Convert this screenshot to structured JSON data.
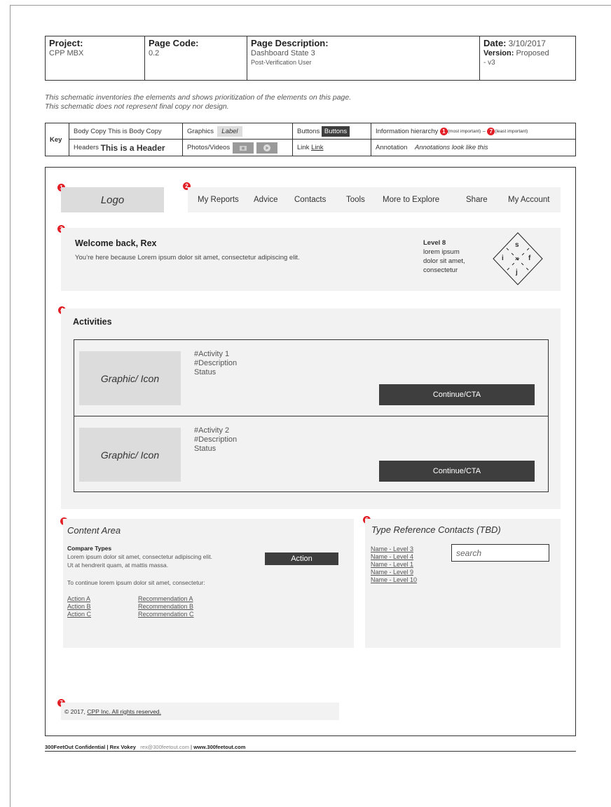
{
  "header": {
    "project_label": "Project:",
    "project_value": "CPP MBX",
    "page_code_label": "Page Code:",
    "page_code_value": "0.2",
    "description_label": "Page Description:",
    "description_value": "Dashboard State 3",
    "description_sub": "Post-Verification User",
    "date_label": "Date:",
    "date_value": "3/10/2017",
    "version_label": "Version:",
    "version_value": "Proposed",
    "version_suffix": "- v3"
  },
  "intro": {
    "line1": "This schematic inventories the elements and shows prioritization of the elements on this page.",
    "line2": "This schematic does not represent final copy nor design."
  },
  "key": {
    "title": "Key",
    "body_copy_label": "Body Copy",
    "body_copy_sample": "This is Body Copy",
    "graphics_label": "Graphics",
    "graphics_sample": "Label",
    "buttons_label": "Buttons",
    "buttons_sample": "Buttons",
    "hierarchy_label": "Information hierarchy",
    "hierarchy_first": "1",
    "hierarchy_first_note": "(most important)",
    "hierarchy_dash": "–",
    "hierarchy_last": "7",
    "hierarchy_last_note": "(least important)",
    "headers_label": "Headers",
    "headers_sample": "This is a Header",
    "photos_label": "Photos/Videos",
    "link_label": "Link",
    "link_sample": "Link",
    "annotation_label": "Annotation",
    "annotation_sample": "Annotations look like this"
  },
  "markers": [
    "1",
    "2",
    "3",
    "4",
    "5",
    "6",
    "7"
  ],
  "logo": "Logo",
  "nav": [
    "My Reports",
    "Advice",
    "Contacts",
    "Tools",
    "More to Explore",
    "Share",
    "My Account"
  ],
  "welcome": {
    "title": "Welcome back, Rex",
    "text": "You’re here because Lorem ipsum dolor sit amet, consectetur adipiscing elit.",
    "level_title": "Level 8",
    "level_lines": [
      "lorem ipsum",
      "dolor sit amet,",
      "consectetur"
    ],
    "diamond": {
      "top": "s",
      "left": "i",
      "center": "×",
      "right": "f",
      "bottom": "j"
    }
  },
  "activities": {
    "title": "Activities",
    "items": [
      {
        "graphic": "Graphic/ Icon",
        "name": "#Activity 1",
        "desc": "#Description",
        "status": "Status",
        "cta": "Continue/CTA"
      },
      {
        "graphic": "Graphic/ Icon",
        "name": "#Activity 2",
        "desc": "#Description",
        "status": "Status",
        "cta": "Continue/CTA"
      }
    ]
  },
  "content_area": {
    "title": "Content Area",
    "subtitle": "Compare Types",
    "text1": "Lorem ipsum dolor sit amet, consectetur adipiscing elit.",
    "text2": "Ut at hendrerit quam, at mattis massa.",
    "action_button": "Action",
    "text3": "To continue lorem ipsum dolor sit amet, consectetur:",
    "actions": [
      "Action A",
      "Action B",
      "Action C"
    ],
    "recommendations": [
      "Recommendation A",
      "Recommendation B",
      "Recommendation C"
    ]
  },
  "contacts": {
    "title": "Type Reference Contacts (TBD)",
    "links": [
      "Name - Level 3",
      "Name - Level 4",
      "Name - Level 1",
      "Name - Level 9",
      "Name - Level 10"
    ],
    "search_placeholder": "search"
  },
  "footer": {
    "copyright": "© 2017,",
    "link": "CPP Inc. All rights reserved."
  },
  "bottom": {
    "company": "300FeetOut Confidential",
    "sep1": "|",
    "author": "Rex Vokey",
    "email": "rex@300feetout.com",
    "sep2": "|",
    "website": "www.300feetout.com"
  },
  "colors": {
    "marker": "#e21f26",
    "dark_button": "#3e3e3e",
    "panel": "#f1f2f1",
    "placeholder": "#dcdcdc"
  }
}
